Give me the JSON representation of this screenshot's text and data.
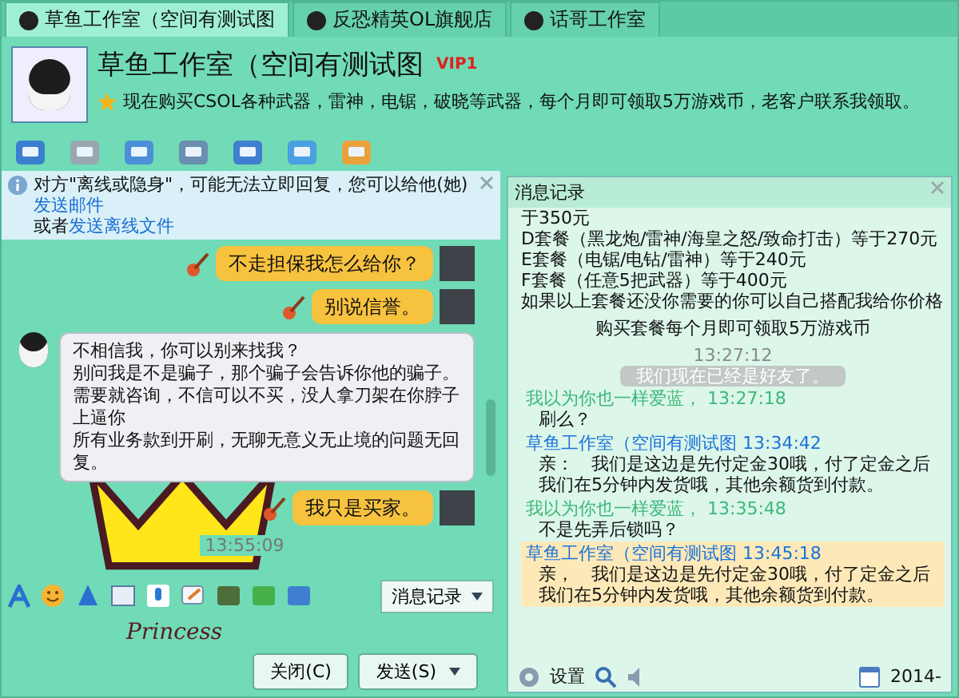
{
  "tabs": [
    {
      "label": "草鱼工作室（空间有测试图",
      "selected": true
    },
    {
      "label": "反恐精英OL旗舰店",
      "selected": false
    },
    {
      "label": "话哥工作室",
      "selected": false
    }
  ],
  "contact": {
    "name": "草鱼工作室（空间有测试图",
    "badge": "VIP1",
    "status": "现在购买CSOL各种武器，雷神，电锯，破晓等武器，每个月即可领取5万游戏币，老客户联系我领取。"
  },
  "notice": {
    "text": "对方\"离线或隐身\"，可能无法立即回复，您可以给他(她)",
    "link_mail": "发送邮件",
    "middle": "或者",
    "link_file": "发送离线文件"
  },
  "messages": [
    {
      "kind": "sent",
      "lines": [
        "不走担保我怎么给你？"
      ]
    },
    {
      "kind": "sent",
      "lines": [
        "别说信誉。"
      ]
    },
    {
      "kind": "received",
      "lines": [
        "不相信我，你可以别来找我？",
        "别问我是不是骗子，那个骗子会告诉你他的骗子。",
        "需要就咨询，不信可以不买，没人拿刀架在你脖子上逼你",
        "所有业务款到开刷，无聊无意义无止境的问题无回复。"
      ]
    },
    {
      "kind": "sent",
      "lines": [
        "我只是买家。"
      ]
    }
  ],
  "time": "13:55:09",
  "sticker_caption": "Princess",
  "record_button": "消息记录",
  "buttons": [
    {
      "label": "关闭(C)",
      "menu": false
    },
    {
      "label": "发送(S)",
      "menu": true
    }
  ],
  "history": {
    "title": "消息记录",
    "entries": [
      {
        "kind": "line",
        "text": "于350元"
      },
      {
        "kind": "line",
        "text": "D套餐（黑龙炮/雷神/海皇之怒/致命打击）等于270元"
      },
      {
        "kind": "line",
        "text": "E套餐（电锯/电钻/雷神）等于240元"
      },
      {
        "kind": "line",
        "text": "F套餐（任意5把武器）等于400元"
      },
      {
        "kind": "line",
        "text": "如果以上套餐还没你需要的你可以自己搭配我给你价格"
      },
      {
        "kind": "center",
        "text": "购买套餐每个月即可领取5万游戏币"
      },
      {
        "kind": "time",
        "text": "13:27:12"
      },
      {
        "kind": "system",
        "text": "我们现在已经是好友了。"
      },
      {
        "kind": "message",
        "sender": "我以为你也一样爱蓝，",
        "time": "13:27:18",
        "color": "#3cb878",
        "text": "刷么？",
        "highlighted": false
      },
      {
        "kind": "message",
        "sender": "草鱼工作室（空间有测试图",
        "time": "13:34:42",
        "color": "#1a73d9",
        "text": "亲：　我们是这边是先付定金30哦，付了定金之后我们在5分钟内发货哦，其他余额货到付款。",
        "highlighted": false
      },
      {
        "kind": "message",
        "sender": "我以为你也一样爱蓝，",
        "time": "13:35:48",
        "color": "#3cb878",
        "text": "不是先弄后锁吗？",
        "highlighted": false
      },
      {
        "kind": "message",
        "sender": "草鱼工作室（空间有测试图",
        "time": "13:45:18",
        "color": "#1a73d9",
        "text": "亲，　我们是这边是先付定金30哦，付了定金之后我们在5分钟内发货哦，其他余额货到付款。",
        "highlighted": true
      }
    ],
    "settings": "设置",
    "date": "2014-"
  }
}
